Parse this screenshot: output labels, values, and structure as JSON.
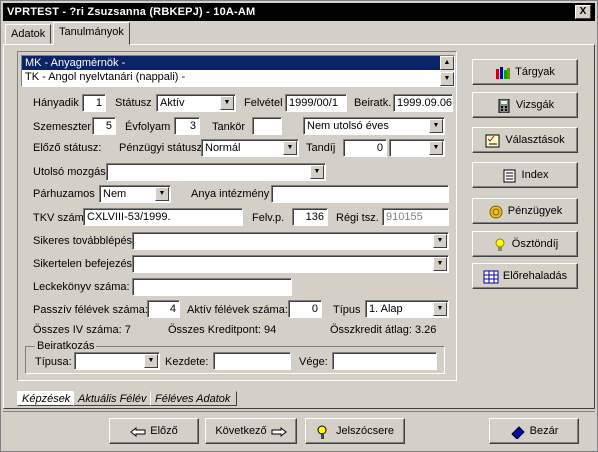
{
  "window": {
    "title": "VPRTEST - ?ri Zsuzsanna (RBKEPJ) - 10A-AM",
    "close": "X"
  },
  "tabs": [
    "Adatok",
    "Tanulmányok"
  ],
  "list": [
    "MK - Anyagmérnök -",
    "TK - Angol nyelvtanári (nappali) -"
  ],
  "labels": {
    "hanyadik": "Hányadik",
    "statusz": "Státusz",
    "felvetel": "Felvétel",
    "beiratk": "Beiratk.",
    "szemeszter": "Szemeszter",
    "evfolyam": "Évfolyam",
    "tankor": "Tankör",
    "elozo_statusz": "Előző státusz:",
    "penzugyi_statusz": "Pénzügyi státusz",
    "tandij": "Tandíj",
    "utolso_mozgas": "Utolsó mozgás",
    "parhuzamos": "Párhuzamos",
    "anya_intezmeny": "Anya intézmény",
    "tkv_szam": "TKV szám",
    "felv_p": "Felv.p.",
    "regi_tsz": "Régi tsz.",
    "sikeres": "Sikeres továbblépés:",
    "sikertelen": "Sikertelen befejezés:",
    "leckekonyv": "Leckekönyv száma:",
    "passziv": "Passzív félévek száma:",
    "aktiv": "Aktív félévek száma:",
    "tipus": "Típus",
    "osszes_iv": "Összes IV száma: 7",
    "osszes_kredit": "Összes Kreditpont: 94",
    "osszkredit_atlag": "Összkredit átlag: 3.26",
    "beiratkozas": "Beiratkozás",
    "tipusa": "Típusa:",
    "kezdete": "Kezdete:",
    "vege": "Vége:"
  },
  "values": {
    "hanyadik": "1",
    "statusz": "Aktív",
    "felvetel": "1999/00/1",
    "beiratk": "1999.09.06",
    "szemeszter": "5",
    "evfolyam": "3",
    "tankor": "",
    "utolso_eves": "Nem utolsó éves",
    "penzugyi_statusz": "Normál",
    "tandij": "0",
    "tandij_combo": "",
    "utolso_mozgas": "",
    "parhuzamos": "Nem",
    "anya_intezmeny": "",
    "tkv_szam": "CXLVIII-53/1999.",
    "felv_p": "136",
    "regi_tsz": "910155",
    "sikeres": "",
    "sikertelen": "",
    "leckekonyv": "",
    "passziv": "4",
    "aktiv": "0",
    "tipus": "1. Alap",
    "tipusa": "",
    "kezdete": "",
    "vege": ""
  },
  "side_buttons": [
    "Tárgyak",
    "Vizsgák",
    "Választások",
    "Index",
    "Pénzügyek",
    "Ösztöndíj",
    "Előrehaladás"
  ],
  "bottom_tabs": [
    "Képzések",
    "Aktuális Félév",
    "Féléves Adatok"
  ],
  "footer_buttons": [
    "Előző",
    "Következő",
    "Jelszócsere",
    "Bezár"
  ]
}
